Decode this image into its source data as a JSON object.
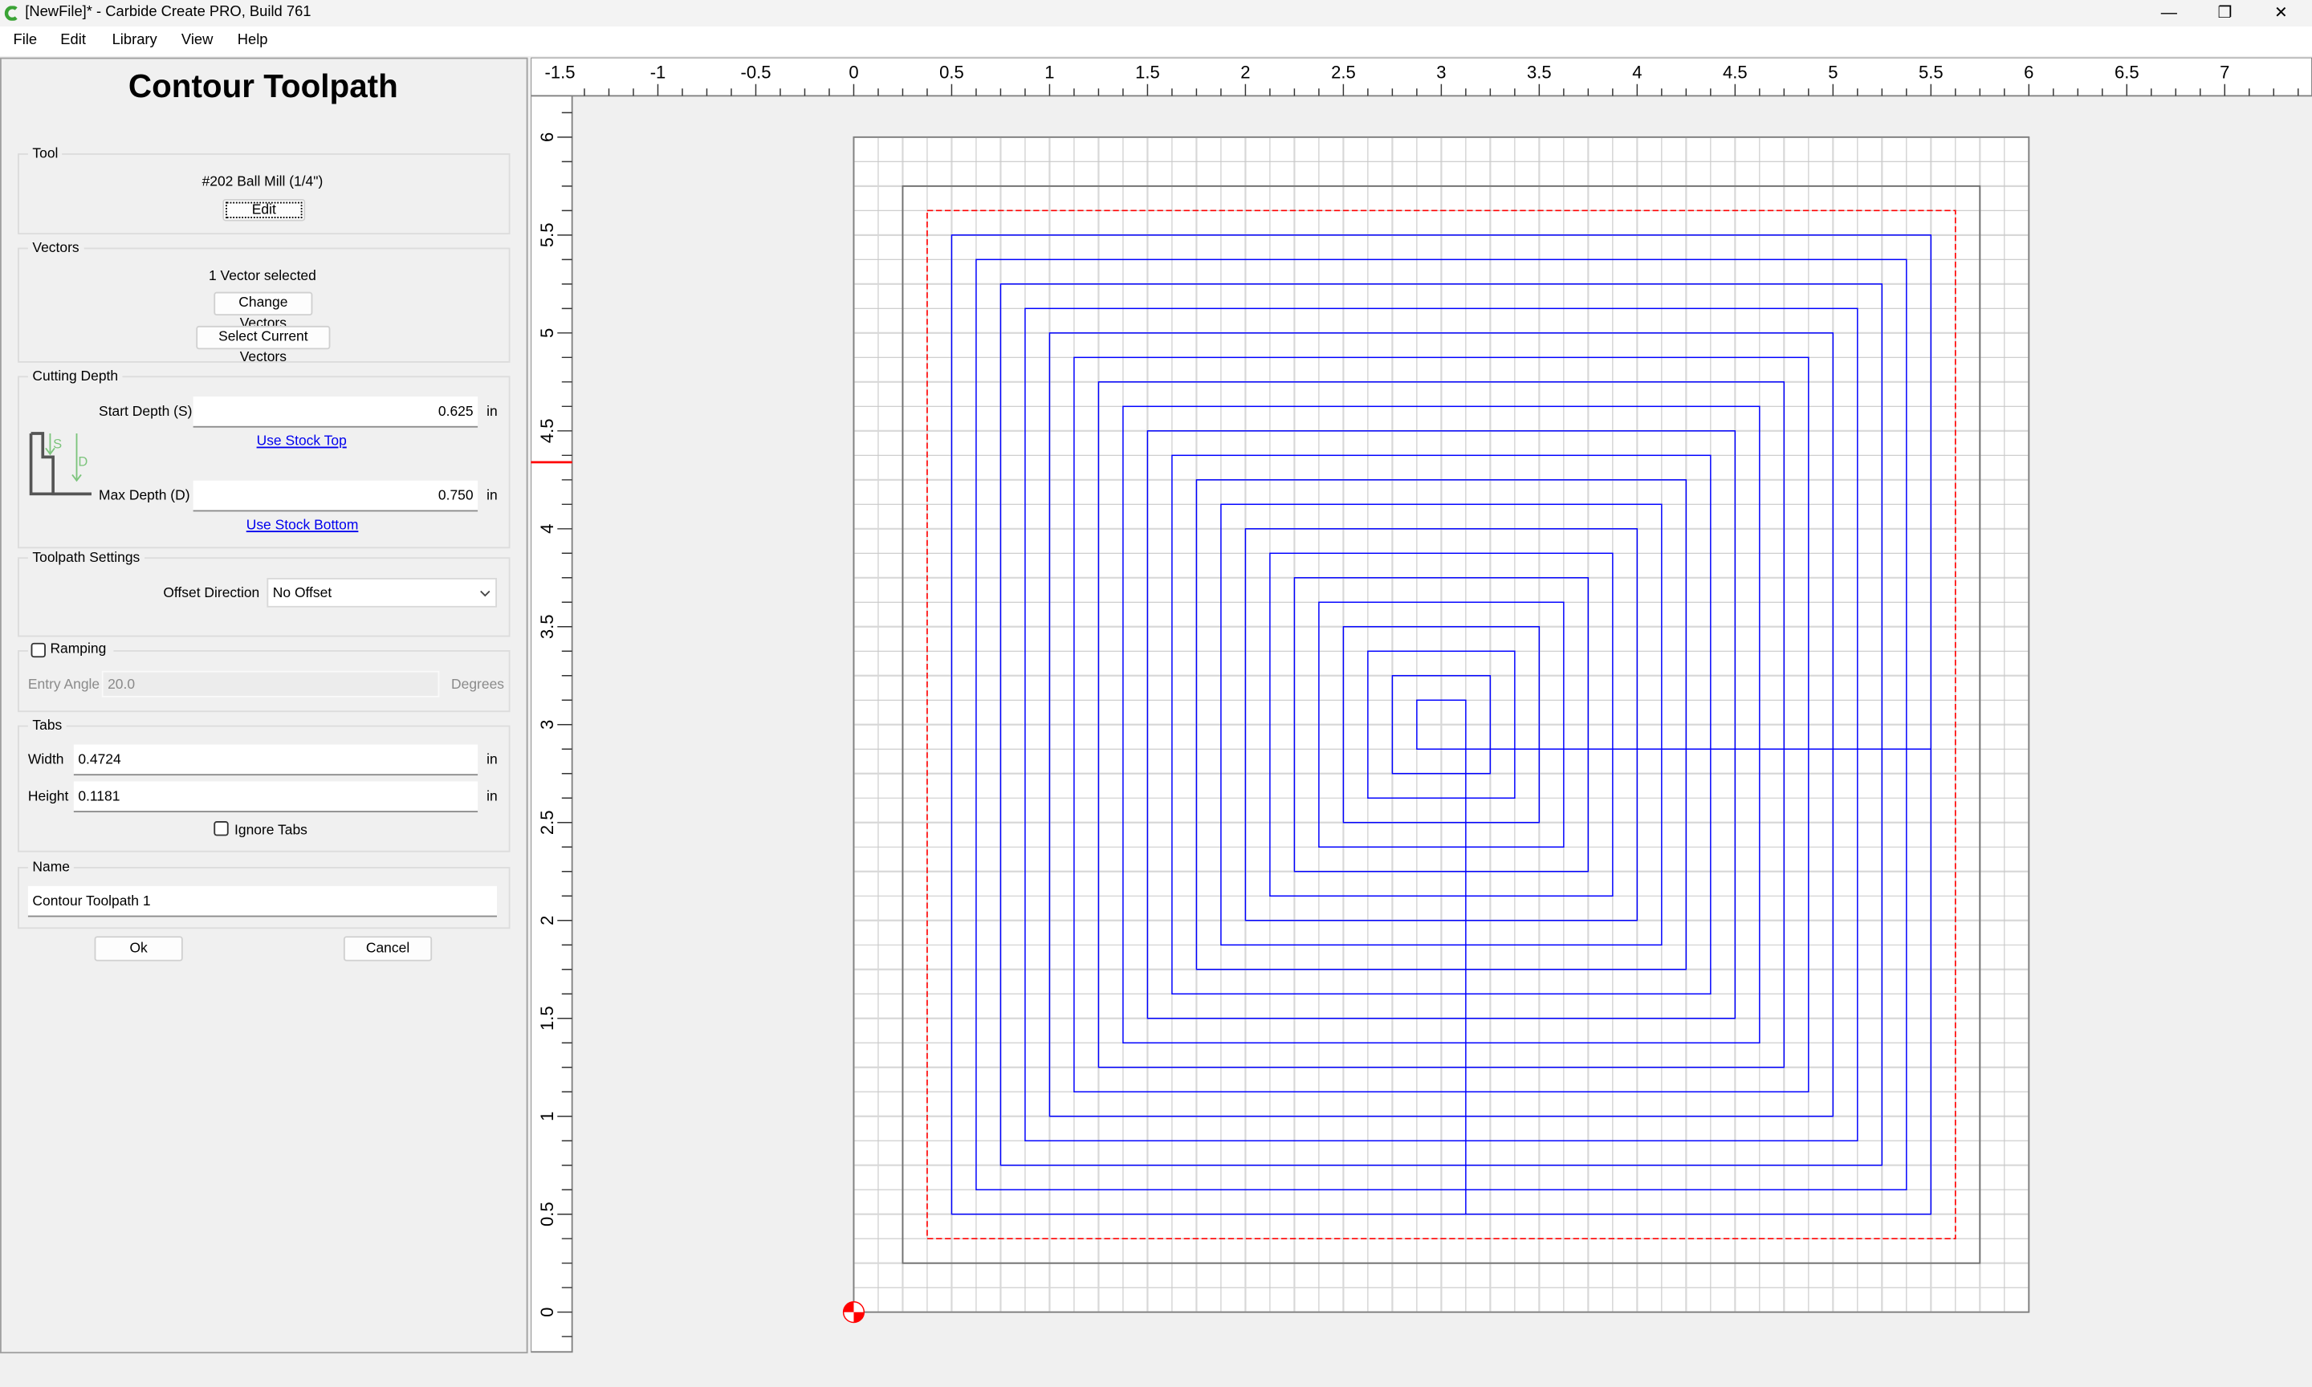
{
  "window": {
    "title": "[NewFile]* - Carbide Create PRO, Build 761",
    "minimize_icon": "minimize-icon",
    "restore_icon": "restore-icon",
    "close_icon": "close-icon"
  },
  "menu": [
    "File",
    "Edit",
    "Library",
    "View",
    "Help"
  ],
  "panel": {
    "title": "Contour Toolpath",
    "tool": {
      "label": "Tool",
      "name": "#202 Ball Mill (1/4\")",
      "edit": "Edit"
    },
    "vectors": {
      "label": "Vectors",
      "status": "1 Vector selected",
      "change": "Change Vectors",
      "select_current": "Select Current Vectors"
    },
    "cutting_depth": {
      "label": "Cutting Depth",
      "start_label": "Start Depth (S)",
      "start_value": "0.625",
      "unit": "in",
      "use_stock_top": "Use Stock Top",
      "max_label": "Max Depth (D)",
      "max_value": "0.750",
      "use_stock_bottom": "Use Stock Bottom",
      "diagram_s": "S",
      "diagram_d": "D"
    },
    "toolpath_settings": {
      "label": "Toolpath Settings",
      "offset_label": "Offset Direction",
      "offset_value": "No Offset"
    },
    "ramping": {
      "label": "Ramping",
      "checked": false,
      "entry_label": "Entry Angle",
      "entry_value": "20.0",
      "entry_unit": "Degrees"
    },
    "tabs": {
      "label": "Tabs",
      "width_label": "Width",
      "width_value": "0.4724",
      "height_label": "Height",
      "height_value": "0.1181",
      "unit": "in",
      "ignore_label": "Ignore Tabs",
      "ignore_checked": false
    },
    "name": {
      "label": "Name",
      "value": "Contour Toolpath 1"
    },
    "ok": "Ok",
    "cancel": "Cancel"
  },
  "canvas": {
    "units": "in",
    "x_ticks": [
      "-1.5",
      "-1",
      "-0.5",
      "0",
      "0.5",
      "1",
      "1.5",
      "2",
      "2.5",
      "3",
      "3.5",
      "4",
      "4.5",
      "5",
      "5.5",
      "6",
      "6.5",
      "7"
    ],
    "y_ticks": [
      "0",
      "0.5",
      "1",
      "1.5",
      "2",
      "2.5",
      "3",
      "3.5",
      "4",
      "4.5",
      "5",
      "5.5",
      "6"
    ],
    "stock": {
      "width": 6,
      "height": 6
    },
    "grid_spacing": 0.125,
    "vector_rect": [
      0.25,
      0.25,
      5.75,
      5.75
    ],
    "selected_rect": [
      0.375,
      0.375,
      5.625,
      5.625
    ],
    "toolpath_center": [
      3,
      3
    ],
    "toolpath_half_sizes_from": 0.125,
    "toolpath_half_sizes_to": 2.5,
    "toolpath_step": 0.125,
    "ruler_marker_y": 4.34,
    "colors": {
      "toolpath": "#0000ff",
      "selected": "#ff0000",
      "vector": "#707070",
      "grid": "#c8c8c8",
      "origin": "#ff0000"
    }
  }
}
